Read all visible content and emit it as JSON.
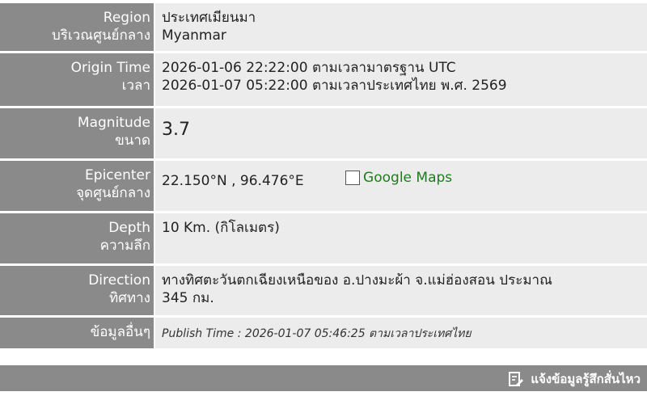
{
  "rows": {
    "region": {
      "label_en": "Region",
      "label_th": "บริเวณศูนย์กลาง",
      "value_th": "ประเทศเมียนมา",
      "value_en": "Myanmar"
    },
    "origin": {
      "label_en": "Origin Time",
      "label_th": "เวลา",
      "utc": "2026-01-06 22:22:00 ตามเวลามาตรฐาน UTC",
      "local": "2026-01-07 05:22:00 ตามเวลาประเทศไทย พ.ศ. 2569"
    },
    "magnitude": {
      "label_en": "Magnitude",
      "label_th": "ขนาด",
      "value": "3.7"
    },
    "epicenter": {
      "label_en": "Epicenter",
      "label_th": "จุดศูนย์กลาง",
      "value": "22.150°N , 96.476°E",
      "maps_link": "Google Maps"
    },
    "depth": {
      "label_en": "Depth",
      "label_th": "ความลึก",
      "value": "10 Km. (กิโลเมตร)"
    },
    "direction": {
      "label_en": "Direction",
      "label_th": "ทิศทาง",
      "line1": "ทางทิศตะวันตกเฉียงเหนือของ อ.ปางมะผ้า จ.แม่ฮ่องสอน ประมาณ",
      "line2": "345 กม."
    },
    "other": {
      "label_th": "ข้อมูลอื่นๆ",
      "publish": "Publish Time : 2026-01-07 05:46:25 ตามเวลาประเทศไทย"
    }
  },
  "footer": {
    "report_label": "แจ้งข้อมูลรู้สึกสั่นไหว",
    "icon": "edit-document-icon"
  },
  "colors": {
    "label_bg": "#8a8a8a",
    "value_bg": "#ececec",
    "link": "#1e7b1e"
  }
}
